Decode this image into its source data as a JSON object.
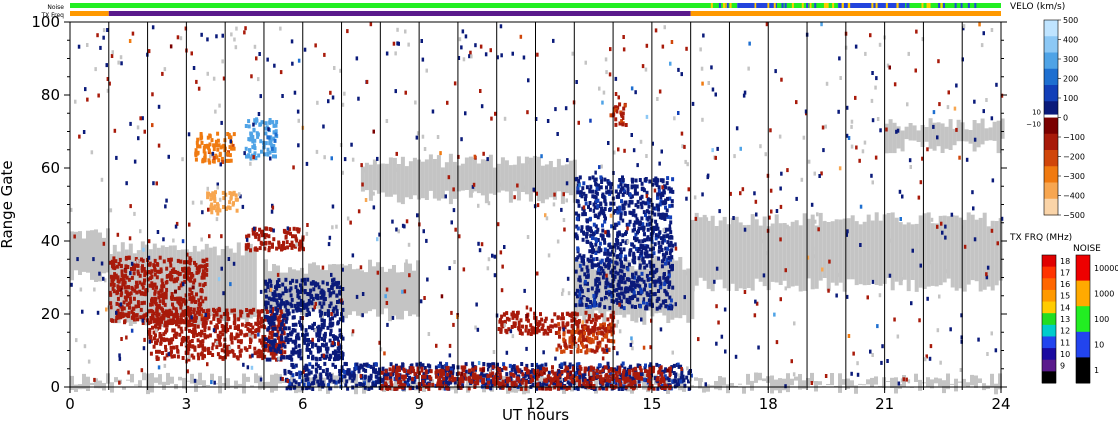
{
  "chart_data": {
    "type": "heatmap",
    "x_label": "UT hours",
    "y_label": "Range Gate",
    "x_ticks": [
      "0",
      "3",
      "6",
      "9",
      "12",
      "15",
      "18",
      "21",
      "24"
    ],
    "y_ticks": [
      "0",
      "20",
      "40",
      "60",
      "80",
      "100"
    ],
    "xlim": [
      0,
      24
    ],
    "ylim": [
      0,
      100
    ],
    "grid": "vertical lines every 1 UT hour",
    "strip_labels": [
      "Noise",
      "TX Freq"
    ],
    "tx_freq_strip": [
      {
        "start": 0,
        "end": 1,
        "color": "#ff9900"
      },
      {
        "start": 1,
        "end": 16,
        "color": "#5a1a8c"
      },
      {
        "start": 16,
        "end": 24,
        "color": "#ff9900"
      }
    ],
    "noise_strip": [
      {
        "start": 0,
        "end": 16.5,
        "color": "#22ee22"
      },
      {
        "start": 16.5,
        "end": 17.2,
        "color": "#22ee22"
      },
      {
        "start": 17.2,
        "end": 18.2,
        "color": "#2244dd"
      },
      {
        "start": 18.2,
        "end": 19.8,
        "color": "#22ee22"
      },
      {
        "start": 19.8,
        "end": 21.5,
        "color": "#2244dd"
      },
      {
        "start": 21.5,
        "end": 24,
        "color": "#22ee22"
      }
    ],
    "velocity_scale": {
      "title": "VELO (km/s)",
      "tick_labels": [
        "500",
        "400",
        "300",
        "200",
        "100",
        "0",
        "−100",
        "−200",
        "−300",
        "−400",
        "−500"
      ],
      "tick_values": [
        500,
        400,
        300,
        200,
        100,
        0,
        -100,
        -200,
        -300,
        -400,
        -500
      ],
      "small_labels": [
        "10",
        "−10"
      ],
      "small_values": [
        10,
        -10
      ],
      "colors": [
        "#bfe4ff",
        "#8cc8f5",
        "#4fa3e6",
        "#1e6fd0",
        "#123fb8",
        "#0a1a7a",
        "#7a0000",
        "#a81a0a",
        "#d0460a",
        "#f07a10",
        "#f7a650",
        "#fad4a8"
      ]
    },
    "txfreq_scale": {
      "title": "TX FRQ (MHz)",
      "tick_labels": [
        "18",
        "17",
        "16",
        "15",
        "14",
        "13",
        "12",
        "11",
        "10",
        "9"
      ],
      "tick_values": [
        18,
        17,
        16,
        15,
        14,
        13,
        12,
        11,
        10,
        9
      ],
      "colors": [
        "#e00000",
        "#ff3300",
        "#ff6600",
        "#ff9900",
        "#ffcc00",
        "#22dd22",
        "#00cccc",
        "#2244ee",
        "#1a0aa0",
        "#5a1a8c",
        "#000000"
      ]
    },
    "noise_scale": {
      "title": "NOISE",
      "tick_labels": [
        "10000",
        "1000",
        "100",
        "10",
        "1"
      ],
      "tick_values": [
        10000,
        1000,
        100,
        10,
        1
      ],
      "colors": [
        "#ee0000",
        "#ffaa00",
        "#22ee22",
        "#2244ee",
        "#000000"
      ]
    },
    "ground_scatter_color": "#c4c4c4",
    "ground_scatter_regions": [
      {
        "t0": 0.0,
        "t1": 1.0,
        "g0": 30,
        "g1": 42
      },
      {
        "t0": 1.0,
        "t1": 4.8,
        "g0": 18,
        "g1": 38
      },
      {
        "t0": 5.0,
        "t1": 9.0,
        "g0": 20,
        "g1": 33
      },
      {
        "t0": 7.5,
        "t1": 13.0,
        "g0": 52,
        "g1": 62
      },
      {
        "t0": 13.0,
        "t1": 16.0,
        "g0": 19,
        "g1": 34
      },
      {
        "t0": 16.0,
        "t1": 24.0,
        "g0": 28,
        "g1": 46
      },
      {
        "t0": 21.0,
        "t1": 24.0,
        "g0": 66,
        "g1": 72
      },
      {
        "t0": 0.0,
        "t1": 24.0,
        "g0": 0,
        "g1": 2
      }
    ],
    "velocity_regions": [
      {
        "t0": 1.0,
        "t1": 3.5,
        "g0": 18,
        "g1": 36,
        "velocity": -120
      },
      {
        "t0": 2.0,
        "t1": 5.5,
        "g0": 8,
        "g1": 22,
        "velocity": -150
      },
      {
        "t0": 5.0,
        "t1": 7.0,
        "g0": 8,
        "g1": 30,
        "velocity": 60
      },
      {
        "t0": 4.5,
        "t1": 6.0,
        "g0": 38,
        "g1": 44,
        "velocity": -150
      },
      {
        "t0": 3.2,
        "t1": 4.2,
        "g0": 62,
        "g1": 70,
        "velocity": -300
      },
      {
        "t0": 4.5,
        "t1": 5.3,
        "g0": 63,
        "g1": 74,
        "velocity": 300
      },
      {
        "t0": 3.5,
        "t1": 4.3,
        "g0": 48,
        "g1": 54,
        "velocity": -400
      },
      {
        "t0": 11.0,
        "t1": 14.0,
        "g0": 15,
        "g1": 21,
        "velocity": -120
      },
      {
        "t0": 12.5,
        "t1": 14.0,
        "g0": 10,
        "g1": 18,
        "velocity": -180
      },
      {
        "t0": 13.0,
        "t1": 15.5,
        "g0": 22,
        "g1": 58,
        "velocity": 70
      },
      {
        "t0": 5.5,
        "t1": 16.0,
        "g0": 0,
        "g1": 7,
        "velocity": 70
      },
      {
        "t0": 8.0,
        "t1": 15.5,
        "g0": 0,
        "g1": 6,
        "velocity": -120
      },
      {
        "t0": 13.9,
        "t1": 14.3,
        "g0": 72,
        "g1": 78,
        "velocity": -160
      }
    ]
  }
}
